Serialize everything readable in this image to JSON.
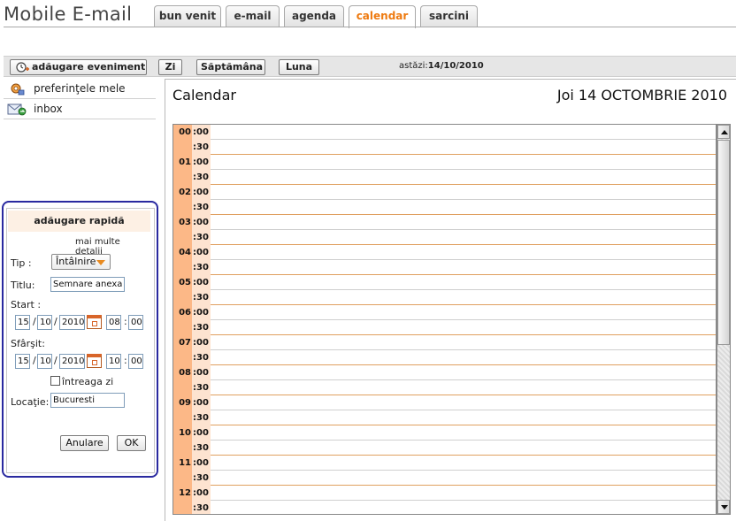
{
  "header": {
    "app_title": "Mobile E-mail",
    "tabs": [
      {
        "label": "bun venit"
      },
      {
        "label": "e-mail"
      },
      {
        "label": "agenda"
      },
      {
        "label": "calendar"
      },
      {
        "label": "sarcini"
      }
    ],
    "active_tab": "calendar",
    "accent_color": "#ee7a10"
  },
  "toolbar": {
    "add_event": "adăugare eveniment",
    "day": "Zi",
    "week": "Săptămâna",
    "month": "Luna",
    "today_label": "astăzi:",
    "today_value": "14/10/2010"
  },
  "sidebar": {
    "items": [
      {
        "label": "preferinţele mele",
        "icon": "preferences-icon"
      },
      {
        "label": "inbox",
        "icon": "inbox-icon"
      }
    ]
  },
  "quick_add": {
    "title": "adăugare rapidă",
    "more_details": "mai multe detalii",
    "type_label": "Tip :",
    "type_value": "Întâlnire",
    "title_label": "Titlu:",
    "title_value": "Semnare anexa",
    "start_label": "Start :",
    "start": {
      "day": "15",
      "month": "10",
      "year": "2010",
      "hour": "08",
      "minute": "00"
    },
    "end_label": "Sfârşit:",
    "end": {
      "day": "15",
      "month": "10",
      "year": "2010",
      "hour": "10",
      "minute": "00"
    },
    "date_sep": "/",
    "time_sep": ":",
    "all_day_label": "întreaga zi",
    "all_day_checked": false,
    "location_label": "Locaţie:",
    "location_value": "Bucuresti",
    "cancel": "Anulare",
    "ok": "OK"
  },
  "calendar": {
    "title": "Calendar",
    "date_heading": "Joi 14 OCTOMBRIE 2010",
    "half_label": ":30",
    "hours": [
      "00",
      "01",
      "02",
      "03",
      "04",
      "05",
      "06",
      "07",
      "08",
      "09",
      "10",
      "11",
      "12"
    ],
    "hour_suffix": ":00"
  }
}
